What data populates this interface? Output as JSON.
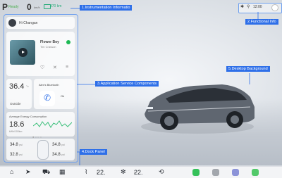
{
  "status": {
    "gear": "P",
    "gear_state": "Ready",
    "speed": "0",
    "speed_unit": "km/h",
    "range": "370 km"
  },
  "top_right": {
    "bluetooth_icon": "bluetooth-icon",
    "signal_icon": "signal-icon",
    "time": "12:00"
  },
  "annotations": {
    "instrumentation": "1.Instrumentation Informatio",
    "functional": "2.Functional Info",
    "application": "3.Application Service Components",
    "dock": "4.Dock Panel",
    "desktop": "5.Desktop Background"
  },
  "greeting": "Hi Changan",
  "music": {
    "song": "Flower Boy",
    "artist": "Tim Crasson"
  },
  "temperature": {
    "value": "36.4",
    "unit": "°c",
    "label": "Outside"
  },
  "bluetooth_phone": {
    "title": "Alex's Bluetooth",
    "status": "Ok"
  },
  "energy": {
    "title": "Average Energy Consumption",
    "value": "18.6",
    "unit": "kWh/100km"
  },
  "tires": {
    "front_left": "34.8",
    "front_right": "34.8",
    "rear_left": "32.8",
    "rear_right": "34.8",
    "unit": "psi"
  },
  "dock": {
    "left_temp": "22.",
    "left_temp_decimal": "5",
    "right_temp": "22.",
    "right_temp_decimal": "5",
    "apps": [
      {
        "name": "phone",
        "color": "#35c15a"
      },
      {
        "name": "messages",
        "color": "#4caf50"
      },
      {
        "name": "media",
        "color": "#7f8fd6"
      },
      {
        "name": "settings",
        "color": "#53c96a"
      }
    ]
  }
}
